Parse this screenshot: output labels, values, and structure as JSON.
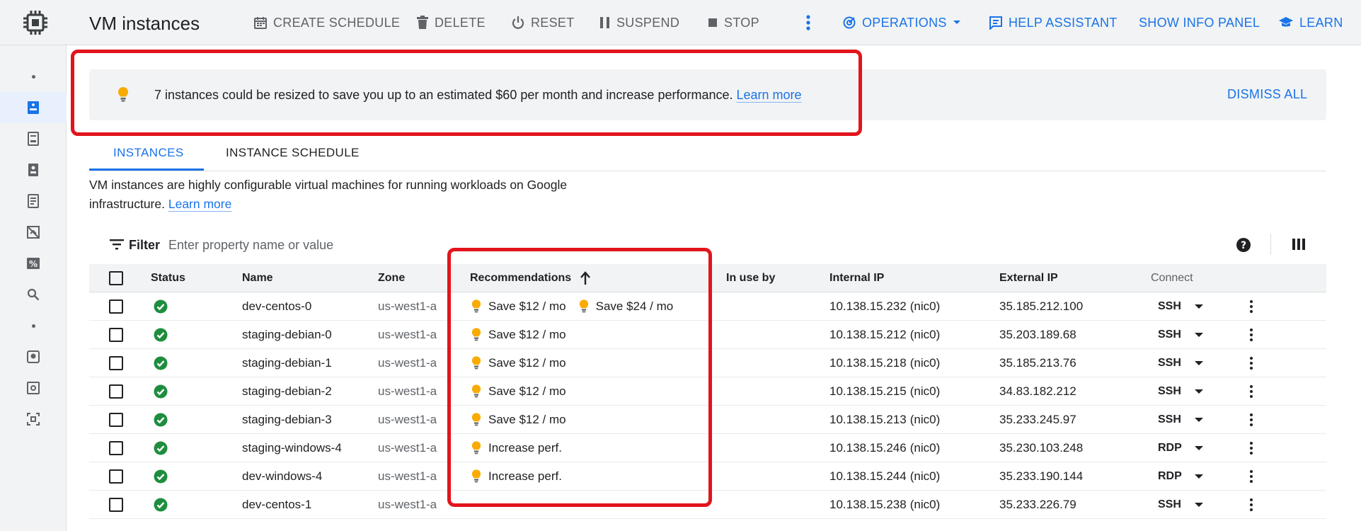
{
  "header": {
    "title": "VM instances",
    "actions": {
      "create_schedule": "CREATE SCHEDULE",
      "delete": "DELETE",
      "reset": "RESET",
      "suspend": "SUSPEND",
      "stop": "STOP",
      "operations": "OPERATIONS",
      "help_assistant": "HELP ASSISTANT",
      "show_info_panel": "SHOW INFO PANEL",
      "learn": "LEARN"
    }
  },
  "banner": {
    "text": "7 instances could be resized to save you up to an estimated $60 per month and increase performance.",
    "link": "Learn more",
    "dismiss": "DISMISS ALL"
  },
  "tabs": [
    "INSTANCES",
    "INSTANCE SCHEDULE"
  ],
  "description": {
    "text": "VM instances are highly configurable virtual machines for running workloads on Google infrastructure.",
    "link": "Learn more"
  },
  "filter": {
    "label": "Filter",
    "placeholder": "Enter property name or value"
  },
  "table": {
    "columns": {
      "status": "Status",
      "name": "Name",
      "zone": "Zone",
      "recommendations": "Recommendations",
      "in_use_by": "In use by",
      "internal_ip": "Internal IP",
      "external_ip": "External IP",
      "connect": "Connect"
    },
    "rows": [
      {
        "name": "dev-centos-0",
        "zone": "us-west1-a",
        "recs": [
          "Save $12 / mo",
          "Save $24 / mo"
        ],
        "internal_ip": "10.138.15.232",
        "nic": "(nic0)",
        "external_ip": "35.185.212.100",
        "connect": "SSH"
      },
      {
        "name": "staging-debian-0",
        "zone": "us-west1-a",
        "recs": [
          "Save $12 / mo"
        ],
        "internal_ip": "10.138.15.212",
        "nic": "(nic0)",
        "external_ip": "35.203.189.68",
        "connect": "SSH"
      },
      {
        "name": "staging-debian-1",
        "zone": "us-west1-a",
        "recs": [
          "Save $12 / mo"
        ],
        "internal_ip": "10.138.15.218",
        "nic": "(nic0)",
        "external_ip": "35.185.213.76",
        "connect": "SSH"
      },
      {
        "name": "staging-debian-2",
        "zone": "us-west1-a",
        "recs": [
          "Save $12 / mo"
        ],
        "internal_ip": "10.138.15.215",
        "nic": "(nic0)",
        "external_ip": "34.83.182.212",
        "connect": "SSH"
      },
      {
        "name": "staging-debian-3",
        "zone": "us-west1-a",
        "recs": [
          "Save $12 / mo"
        ],
        "internal_ip": "10.138.15.213",
        "nic": "(nic0)",
        "external_ip": "35.233.245.97",
        "connect": "SSH"
      },
      {
        "name": "staging-windows-4",
        "zone": "us-west1-a",
        "recs": [
          "Increase perf."
        ],
        "internal_ip": "10.138.15.246",
        "nic": "(nic0)",
        "external_ip": "35.230.103.248",
        "connect": "RDP"
      },
      {
        "name": "dev-windows-4",
        "zone": "us-west1-a",
        "recs": [
          "Increase perf."
        ],
        "internal_ip": "10.138.15.244",
        "nic": "(nic0)",
        "external_ip": "35.233.190.144",
        "connect": "RDP"
      },
      {
        "name": "dev-centos-1",
        "zone": "us-west1-a",
        "recs": [],
        "internal_ip": "10.138.15.238",
        "nic": "(nic0)",
        "external_ip": "35.233.226.79",
        "connect": "SSH"
      }
    ]
  },
  "colors": {
    "accent": "#1a73e8",
    "success": "#1e8e3e",
    "bulb": "#f9ab00",
    "callout": "#e2141c"
  },
  "icons": [
    "chip-icon",
    "calendar-icon",
    "trash-icon",
    "power-icon",
    "pause-icon",
    "stop-icon",
    "more-vert-icon",
    "operations-icon",
    "chevron-down-icon",
    "chat-icon",
    "school-icon",
    "lightbulb-icon",
    "filter-icon",
    "help-icon",
    "columns-icon",
    "check-circle-icon"
  ]
}
